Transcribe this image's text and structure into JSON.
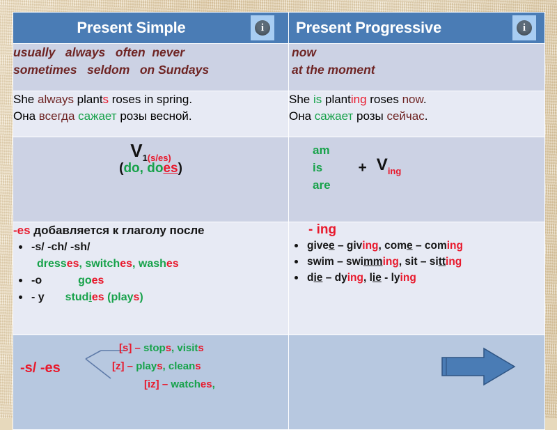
{
  "header": {
    "columns": [
      {
        "title": "Present Simple",
        "info_icon": "info-icon",
        "info_glyph": "i"
      },
      {
        "title": "Present Progressive",
        "info_icon": "info-icon",
        "info_glyph": "i"
      }
    ]
  },
  "row_markers": {
    "simple_line1": "usually   always   often  never",
    "simple_line2": "sometimes   seldom   on Sundays",
    "progressive_line1": "now",
    "progressive_line2": "at the moment"
  },
  "row_examples": {
    "simple": {
      "en_1": "She ",
      "en_adv": "always",
      "en_2": " plant",
      "en_s": "s",
      "en_3": " roses in spring.",
      "ru_1": "Она ",
      "ru_adv": "всегда",
      "ru_2": " ",
      "ru_verb": "сажает",
      "ru_3": " розы весной."
    },
    "progressive": {
      "en_1": "She ",
      "en_aux": "is",
      "en_2": " plant",
      "en_ing": "ing",
      "en_3": " roses ",
      "en_now": "now",
      "en_4": ".",
      "ru_1": "Она ",
      "ru_verb": "сажает",
      "ru_2": " розы ",
      "ru_now": "сейчас",
      "ru_3": "."
    }
  },
  "row_formula": {
    "simple": {
      "v": "V",
      "sub_num": "1",
      "sub_ending": "(s/es)",
      "aux_open": "(",
      "aux_do": "do, do",
      "aux_es": "es",
      "aux_close": ")"
    },
    "progressive": {
      "am": "am",
      "is": "is",
      "are": "are",
      "plus": "+",
      "v": "V",
      "ing": "ing"
    }
  },
  "row_spelling": {
    "simple": {
      "heading_kw": "-es",
      "heading_rest": " добавляется к глаголу после",
      "items": [
        {
          "rule": "-s/ -ch/ -sh/",
          "examples": ""
        },
        {
          "rule": "-o",
          "examples": "goes"
        },
        {
          "rule": "- y",
          "examples": "studies (plays)"
        }
      ],
      "examples_line": "dresses, switches, washes",
      "ex_dress_stem": "dress",
      "ex_dress_end": "es",
      "ex_switch_stem": "switch",
      "ex_switch_end": "es",
      "ex_wash_stem": "wash",
      "ex_wash_end": "es",
      "ex_go_stem": "go",
      "ex_go_end": "es",
      "ex_stud_stem": "stud",
      "ex_stud_i": "i",
      "ex_stud_end": "es",
      "ex_play_open": "(play",
      "ex_play_end": "s",
      "ex_play_close": ")"
    },
    "progressive": {
      "heading": "- ing",
      "items": [
        "give – giving, come – coming",
        "swim – swimming, sit – sitting",
        "die – dying, lie - lying"
      ]
    }
  },
  "row_pronunciation": {
    "label": "-s/ -es",
    "lines": [
      {
        "sound": "[s]",
        "dash": " – ",
        "words_green_1": "stop",
        "words_red_1": "s",
        "sep": ", ",
        "words_green_2": "visit",
        "words_red_2": "s"
      },
      {
        "sound": "[z]",
        "dash": " – ",
        "words_green_1": "play",
        "words_red_1": "s",
        "sep": ", ",
        "words_green_2": "clean",
        "words_red_2": "s"
      },
      {
        "sound": "[iz]",
        "dash": " – ",
        "words_green_1": "watch",
        "words_red_1": "es",
        "sep": ",",
        "words_green_2": "",
        "words_red_2": ""
      }
    ],
    "arrow_icon": "right-arrow-icon"
  },
  "colors": {
    "header_blue": "#4a7cb5",
    "row_dark": "#ccd2e4",
    "row_light": "#e7eaf4",
    "row_blue": "#b7c8e0",
    "accent_red": "#e8192c",
    "accent_green": "#17a24a",
    "accent_maroon": "#6e2423"
  }
}
